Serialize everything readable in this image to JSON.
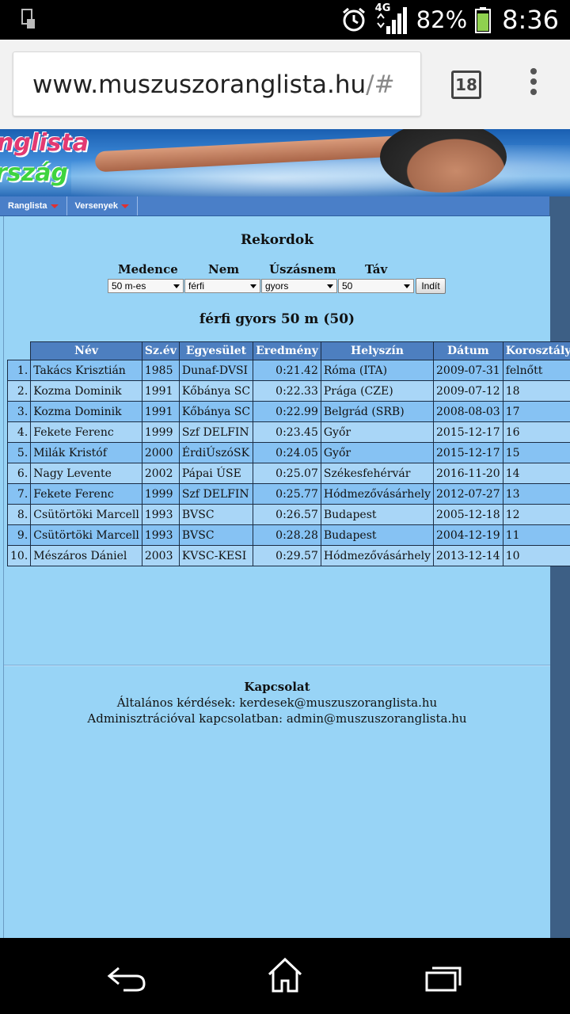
{
  "status_bar": {
    "network": "4G",
    "battery": "82%",
    "time": "8:36",
    "icons": [
      "sim-icon",
      "alarm-icon",
      "signal-icon",
      "battery-icon"
    ]
  },
  "browser": {
    "url_main": "www.muszuszoranglista.hu",
    "url_suffix": "/#",
    "tab_count": "18"
  },
  "banner": {
    "title_line1": "nglista",
    "title_line2": "rszág"
  },
  "nav": {
    "items": [
      {
        "label": "Ranglista"
      },
      {
        "label": "Versenyek"
      }
    ]
  },
  "page": {
    "title": "Rekordok",
    "filters": {
      "labels": [
        "Medence",
        "Nem",
        "Úszásnem",
        "Táv"
      ],
      "values": [
        "50 m-es",
        "férfi",
        "gyors",
        "50"
      ],
      "button": "Indít"
    },
    "table_title": "férfi gyors 50 m (50)",
    "table": {
      "headers": [
        "Név",
        "Sz.év",
        "Egyesület",
        "Eredmény",
        "Helyszín",
        "Dátum",
        "Korosztály"
      ],
      "rows": [
        [
          "1.",
          "Takács Krisztián",
          "1985",
          "Dunaf-DVSI",
          "0:21.42",
          "Róma (ITA)",
          "2009-07-31",
          "felnőtt"
        ],
        [
          "2.",
          "Kozma Dominik",
          "1991",
          "Kőbánya SC",
          "0:22.33",
          "Prága (CZE)",
          "2009-07-12",
          "18"
        ],
        [
          "3.",
          "Kozma Dominik",
          "1991",
          "Kőbánya SC",
          "0:22.99",
          "Belgrád (SRB)",
          "2008-08-03",
          "17"
        ],
        [
          "4.",
          "Fekete Ferenc",
          "1999",
          "Szf DELFIN",
          "0:23.45",
          "Győr",
          "2015-12-17",
          "16"
        ],
        [
          "5.",
          "Milák Kristóf",
          "2000",
          "ÉrdiÚszóSK",
          "0:24.05",
          "Győr",
          "2015-12-17",
          "15"
        ],
        [
          "6.",
          "Nagy Levente",
          "2002",
          "Pápai ÚSE",
          "0:25.07",
          "Székesfehérvár",
          "2016-11-20",
          "14"
        ],
        [
          "7.",
          "Fekete Ferenc",
          "1999",
          "Szf DELFIN",
          "0:25.77",
          "Hódmezővásárhely",
          "2012-07-27",
          "13"
        ],
        [
          "8.",
          "Csütörtöki Marcell",
          "1993",
          "BVSC",
          "0:26.57",
          "Budapest",
          "2005-12-18",
          "12"
        ],
        [
          "9.",
          "Csütörtöki Marcell",
          "1993",
          "BVSC",
          "0:28.28",
          "Budapest",
          "2004-12-19",
          "11"
        ],
        [
          "10.",
          "Mészáros Dániel",
          "2003",
          "KVSC-KESI",
          "0:29.57",
          "Hódmezővásárhely",
          "2013-12-14",
          "10"
        ]
      ]
    },
    "footer": {
      "heading": "Kapcsolat",
      "line1": "Általános kérdések: kerdesek@muszuszoranglista.hu",
      "line2": "Adminisztrációval kapcsolatban: admin@muszuszoranglista.hu"
    }
  },
  "android_nav": [
    "back-icon",
    "home-icon",
    "recents-icon"
  ]
}
